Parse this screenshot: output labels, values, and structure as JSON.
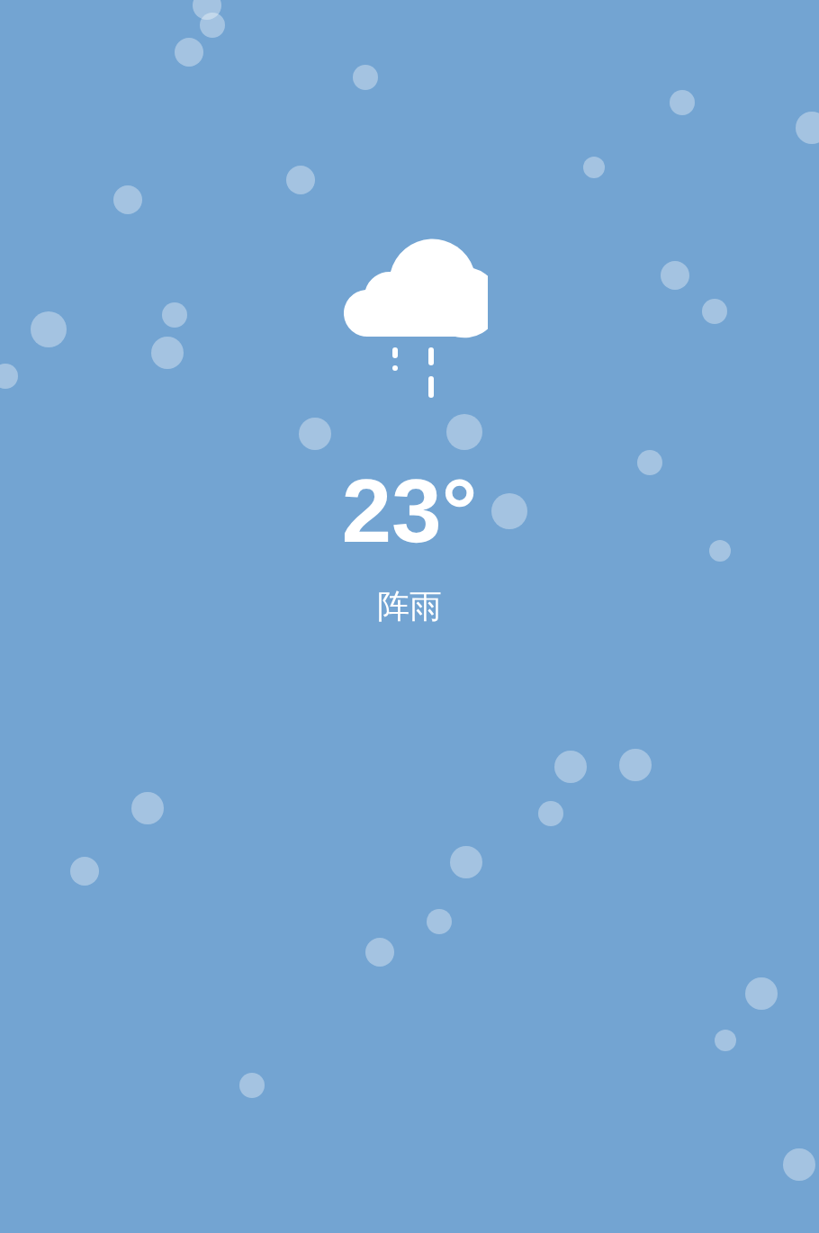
{
  "temperature": "23°",
  "condition": "阵雨"
}
